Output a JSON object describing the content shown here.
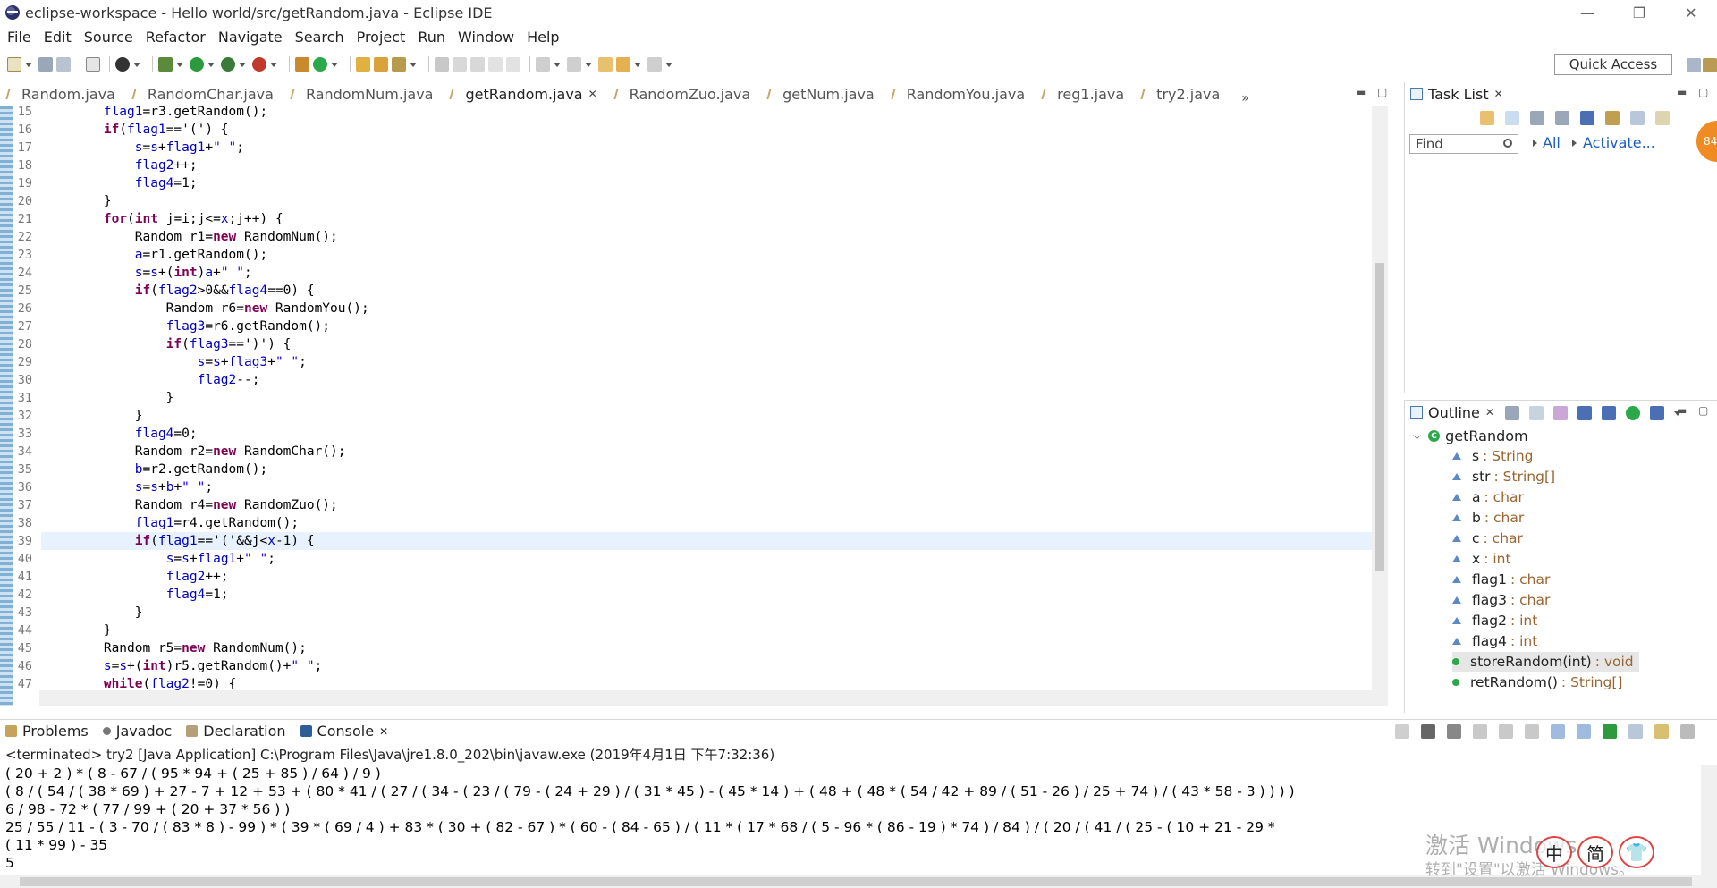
{
  "window": {
    "title": "eclipse-workspace - Hello world/src/getRandom.java - Eclipse IDE",
    "controls": [
      "—",
      "❐",
      "✕"
    ]
  },
  "menu": [
    "File",
    "Edit",
    "Source",
    "Refactor",
    "Navigate",
    "Search",
    "Project",
    "Run",
    "Window",
    "Help"
  ],
  "toolbar": {
    "quick_access": "Quick Access"
  },
  "editor": {
    "tabs": [
      {
        "label": "Random.java",
        "active": false
      },
      {
        "label": "RandomChar.java",
        "active": false
      },
      {
        "label": "RandomNum.java",
        "active": false
      },
      {
        "label": "getRandom.java",
        "active": true
      },
      {
        "label": "RandomZuo.java",
        "active": false
      },
      {
        "label": "getNum.java",
        "active": false
      },
      {
        "label": "RandomYou.java",
        "active": false
      },
      {
        "label": "reg1.java",
        "active": false
      },
      {
        "label": "try2.java",
        "active": false
      }
    ],
    "more_tabs": "»",
    "lines": [
      {
        "n": "15",
        "text": "        flag1=r3.getRandom();"
      },
      {
        "n": "16",
        "text": "        if(flag1=='(') {"
      },
      {
        "n": "17",
        "text": "            s=s+flag1+\" \";"
      },
      {
        "n": "18",
        "text": "            flag2++;"
      },
      {
        "n": "19",
        "text": "            flag4=1;"
      },
      {
        "n": "20",
        "text": "        }"
      },
      {
        "n": "21",
        "text": "        for(int j=i;j<=x;j++) {"
      },
      {
        "n": "22",
        "text": "            Random r1=new RandomNum();"
      },
      {
        "n": "23",
        "text": "            a=r1.getRandom();"
      },
      {
        "n": "24",
        "text": "            s=s+(int)a+\" \";"
      },
      {
        "n": "25",
        "text": "            if(flag2>0&&flag4==0) {"
      },
      {
        "n": "26",
        "text": "                Random r6=new RandomYou();"
      },
      {
        "n": "27",
        "text": "                flag3=r6.getRandom();"
      },
      {
        "n": "28",
        "text": "                if(flag3==')') {"
      },
      {
        "n": "29",
        "text": "                    s=s+flag3+\" \";"
      },
      {
        "n": "30",
        "text": "                    flag2--;"
      },
      {
        "n": "31",
        "text": "                }"
      },
      {
        "n": "32",
        "text": "            }"
      },
      {
        "n": "33",
        "text": "            flag4=0;"
      },
      {
        "n": "34",
        "text": "            Random r2=new RandomChar();"
      },
      {
        "n": "35",
        "text": "            b=r2.getRandom();"
      },
      {
        "n": "36",
        "text": "            s=s+b+\" \";"
      },
      {
        "n": "37",
        "text": "            Random r4=new RandomZuo();"
      },
      {
        "n": "38",
        "text": "            flag1=r4.getRandom();"
      },
      {
        "n": "39",
        "text": "            if(flag1=='('&&j<x-1) {",
        "highlight": true
      },
      {
        "n": "40",
        "text": "                s=s+flag1+\" \";"
      },
      {
        "n": "41",
        "text": "                flag2++;"
      },
      {
        "n": "42",
        "text": "                flag4=1;"
      },
      {
        "n": "43",
        "text": "            }"
      },
      {
        "n": "44",
        "text": "        }"
      },
      {
        "n": "45",
        "text": "        Random r5=new RandomNum();"
      },
      {
        "n": "46",
        "text": "        s=s+(int)r5.getRandom()+\" \";"
      },
      {
        "n": "47",
        "text": "        while(flag2!=0) {"
      }
    ]
  },
  "task_list": {
    "title": "Task List",
    "find_placeholder": "Find",
    "filter_all": "All",
    "filter_activate": "Activate...",
    "badge": "84"
  },
  "outline": {
    "title": "Outline",
    "root": "getRandom",
    "items": [
      {
        "name": "s",
        "type": ": String",
        "kind": "field"
      },
      {
        "name": "str",
        "type": ": String[]",
        "kind": "field"
      },
      {
        "name": "a",
        "type": ": char",
        "kind": "field"
      },
      {
        "name": "b",
        "type": ": char",
        "kind": "field"
      },
      {
        "name": "c",
        "type": ": char",
        "kind": "field"
      },
      {
        "name": "x",
        "type": ": int",
        "kind": "field"
      },
      {
        "name": "flag1",
        "type": ": char",
        "kind": "field"
      },
      {
        "name": "flag3",
        "type": ": char",
        "kind": "field"
      },
      {
        "name": "flag2",
        "type": ": int",
        "kind": "field"
      },
      {
        "name": "flag4",
        "type": ": int",
        "kind": "field"
      },
      {
        "name": "storeRandom(int)",
        "type": ": void",
        "kind": "method",
        "selected": true
      },
      {
        "name": "retRandom()",
        "type": ": String[]",
        "kind": "method"
      }
    ]
  },
  "bottom": {
    "tabs": [
      {
        "label": "Problems",
        "active": false
      },
      {
        "label": "Javadoc",
        "active": false
      },
      {
        "label": "Declaration",
        "active": false
      },
      {
        "label": "Console",
        "active": true
      }
    ],
    "status": "<terminated> try2 [Java Application] C:\\Program Files\\Java\\jre1.8.0_202\\bin\\javaw.exe (2019年4月1日 下午7:32:36)",
    "output": [
      "( 20 + 2 ) * ( 8 - 67 / ( 95 * 94 + ( 25 + 85 ) / 64 ) / 9 )",
      "( 8 / ( 54 / ( 38 * 69 ) + 27 - 7 + 12 + 53 + ( 80 * 41 / ( 27 / ( 34 - ( 23 / ( 79 - ( 24 + 29 ) / ( 31 * 45 ) - ( 45 * 14 ) + ( 48 + ( 48 * ( 54 / 42 + 89 / ( 51 - 26 ) / 25 + 74 ) / ( 43 * 58 - 3 ) ) ) )",
      "6 / 98 - 72 * ( 77 / 99 + ( 20 + 37 * 56 ) )",
      "25 / 55 / 11 - ( 3 - 70 / ( 83 * 8 ) - 99 ) * ( 39 * ( 69 / 4 ) + 83 * ( 30 + ( 82 - 67 ) * ( 60 - ( 84 - 65 ) / ( 11 * ( 17 * 68 / ( 5 - 96 * ( 86 - 19 ) * 74 ) / 84 ) / ( 20 / ( 41 / ( 25 - ( 10 + 21 - 29 *",
      "( 11 * 99 ) - 35",
      "5"
    ],
    "watermark_line1": "激活 Windows",
    "watermark_line2": "转到\"设置\"以激活 Windows。",
    "ime": [
      "中",
      "简",
      "👕"
    ]
  }
}
